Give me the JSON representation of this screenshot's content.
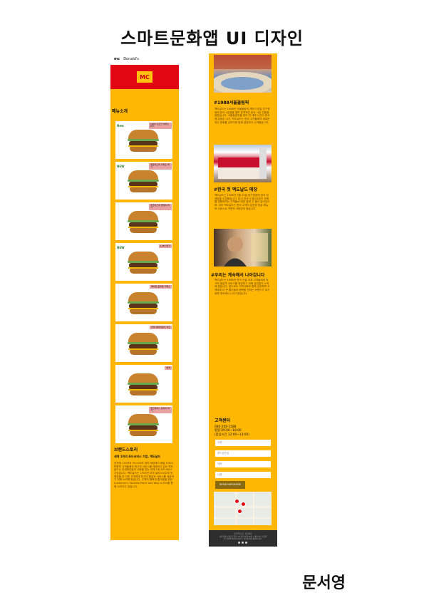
{
  "page_title": "스마트문화앱 UI 디자인",
  "author": "문서영",
  "left_screen": {
    "topbar": {
      "mc_mark": "mc",
      "brand": "Donald's"
    },
    "logo_text": "MC",
    "menu_section_title": "메뉴소개",
    "menu_items": [
      {
        "name": "1955 스모크 하우스 버거",
        "badge": "New"
      },
      {
        "name": "맥크리스피 디럭스 버거",
        "badge": "NEW"
      },
      {
        "name": "맥크리스피 클래식 버거",
        "badge": ""
      },
      {
        "name": "1955 버거",
        "badge": "NEW"
      },
      {
        "name": "베이컨 토마토 디럭스",
        "badge": ""
      },
      {
        "name": "더블 쿼터파운더 치즈",
        "badge": ""
      },
      {
        "name": "빅맥",
        "badge": ""
      },
      {
        "name": "맥스파이시 상하이 버거",
        "badge": ""
      }
    ],
    "brand_story": {
      "title": "브랜드스토리",
      "subtitle": "세계 1위의 푸드서비스 기업, 맥도날드",
      "body": "전세계 120개국 39,000여 개의 매장에서 매일 6,900만명의 고객들에게 최고의 서비스를 제공하고 있는 맥도날드는 전세계인들의 사랑을 받는 세계 1위 푸드서비스 기업입니다. 맥도날드는 1955년 미국 일리노이주에 첫 매장을 연 이후 고객에게 최고의 품질과 서비스를 제공하기 위해 노력해 왔습니다. 고객의 행복과 즐거움을 위한 Customer's Favorite Place and Way to Eat을 향해 나아가고 있습니다."
    }
  },
  "right_screen": {
    "sections": [
      {
        "title": "#1988서울올림픽",
        "body": "맥도날드는 1988년 서울올림픽 개막식 당일 압구정동에 한국 1호점을 열며 본격적인 한국 시장 진출을 알렸습니다. 서울올림픽을 맞아 전 세계 시선이 한국에 집중된 시기, 맥도날드는 한국 고객들에게 새로운 외식 문화를 선보이며 함께 성장하기 시작했습니다."
      },
      {
        "title": "#한국 첫 맥도날드 매장",
        "body": "맥도날드는 1988년 3월 29일 압구정동에 한국 첫 매장을 오픈했습니다. 당시 미국식 패스트푸드 문화를 경험하려는 고객들로 매장 앞에 긴 줄이 늘어섰으며, 이후 맥도날드는 한국 고객의 입맛에 맞춘 메뉴와 서비스로 꾸준히 사랑받아 왔습니다."
      },
      {
        "title": "#우리는 계속해서 나아갑니다",
        "body": "맥도날드는 1988년 한국 진출 이후 고객들에게 최고의 품질과 서비스를 제공하기 위해 끊임없이 노력해 왔습니다. 앞으로도 지역사회와 함께 성장하며 고객에게 더 큰 즐거움과 행복을 전하는 브랜드가 되기 위해 계속해서 나아가겠습니다."
      }
    ],
    "contact": {
      "title": "고객센터",
      "phone": "080-208-1588",
      "hours": "평일 09:00~18:00",
      "lunch": "(점심시간 12:00~13:00)",
      "fields": [
        {
          "placeholder": "이름"
        },
        {
          "placeholder": "핸드폰번호"
        },
        {
          "placeholder": "제목"
        },
        {
          "placeholder": "내용"
        }
      ],
      "send_label": "SEND MESSAGE"
    },
    "footer": {
      "line1": "한국맥도날드 유한회사",
      "line2": "서울특별시 종로구 종로 51 종로타워 20층 | 대표이사 김기원",
      "line3": "© 2024 McDonald's. All Rights Reserved."
    }
  }
}
